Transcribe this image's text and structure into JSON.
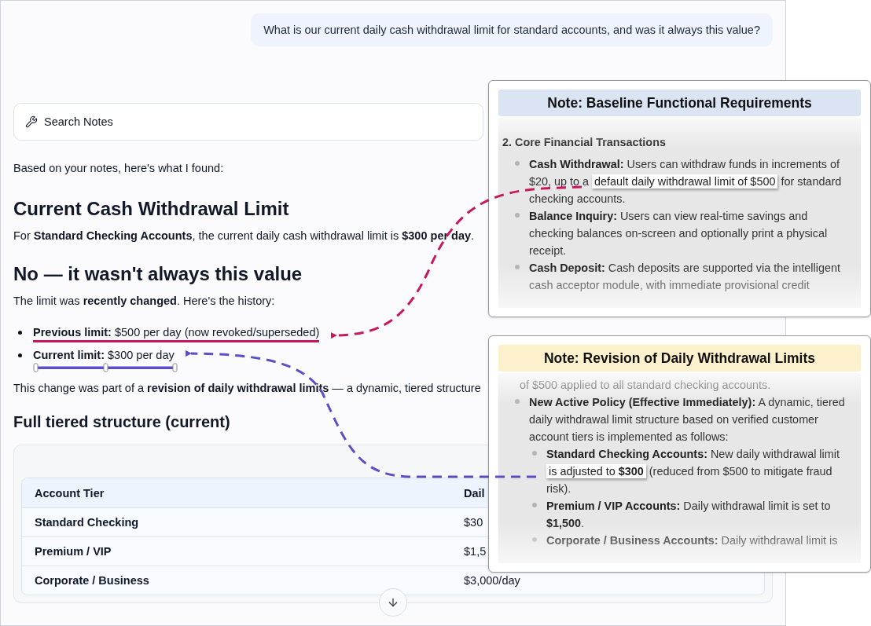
{
  "chat": {
    "question": "What is our current daily cash withdrawal limit for standard accounts, and was it always this value?"
  },
  "search": {
    "label": "Search Notes"
  },
  "answer": {
    "intro": "Based on your notes, here's what I found:",
    "heading_1": "Current Cash Withdrawal Limit",
    "paragraph_1": "For **Standard Checking Accounts**, the current daily cash withdrawal limit is **$300 per day**.",
    "heading_2": "No — it wasn't always this value",
    "paragraph_2": "The limit was **recently changed**. Here's the history:",
    "history": [
      {
        "label": "Previous limit:",
        "value": "$500 per day (now revoked/superseded)",
        "kind": "underline"
      },
      {
        "label": "Current limit:",
        "value": "$300 per day",
        "kind": "selection"
      }
    ],
    "paragraph_3": "This change was part of a **revision of daily withdrawal limits** — a dynamic, tiered structure",
    "heading_3": "Full tiered structure (current)",
    "table": {
      "columns": [
        "Account Tier",
        "Dail"
      ],
      "rows": [
        [
          "Standard Checking",
          "$30"
        ],
        [
          "Premium / VIP",
          "$1,5"
        ],
        [
          "Corporate / Business",
          "$3,000/day"
        ]
      ]
    }
  },
  "notes": [
    {
      "title": "Note: Baseline Functional Requirements",
      "color": "#dbe4f3",
      "section_heading": "2. Core Financial Transactions",
      "items": [
        {
          "label": "Cash Withdrawal:",
          "before": "Users can withdraw funds in increments of $20, up to a ",
          "highlight": "default daily withdrawal limit of $500",
          "after": " for standard checking accounts."
        },
        {
          "label": "Balance Inquiry:",
          "before": "Users can view real-time savings and checking balances on-screen and optionally print a physical receipt."
        },
        {
          "label": "Cash Deposit:",
          "before": "Cash deposits are supported via the intelligent cash acceptor module, with immediate provisional credit"
        }
      ]
    },
    {
      "title": "Note: Revision of Daily Withdrawal Limits",
      "color": "#fdf0cc",
      "cut_line": "of $500 applied to all standard checking accounts.",
      "items": [
        {
          "label": "New Active Policy (Effective Immediately):",
          "before": "A dynamic, tiered daily withdrawal limit structure based on verified customer account tiers is implemented as follows:",
          "children": [
            {
              "label": "Standard Checking Accounts:",
              "before": "New daily withdrawal limit ",
              "highlight": "is adjusted to **$300**",
              "after": " (reduced from $500 to mitigate fraud risk)."
            },
            {
              "label": "Premium / VIP Accounts:",
              "before": "Daily withdrawal limit is set to **$1,500**."
            },
            {
              "label": "Corporate / Business Accounts:",
              "before": "Daily withdrawal limit is"
            }
          ]
        }
      ]
    }
  ],
  "connectors": [
    {
      "color": "#c8175d"
    },
    {
      "color": "#5b4fc4"
    }
  ]
}
